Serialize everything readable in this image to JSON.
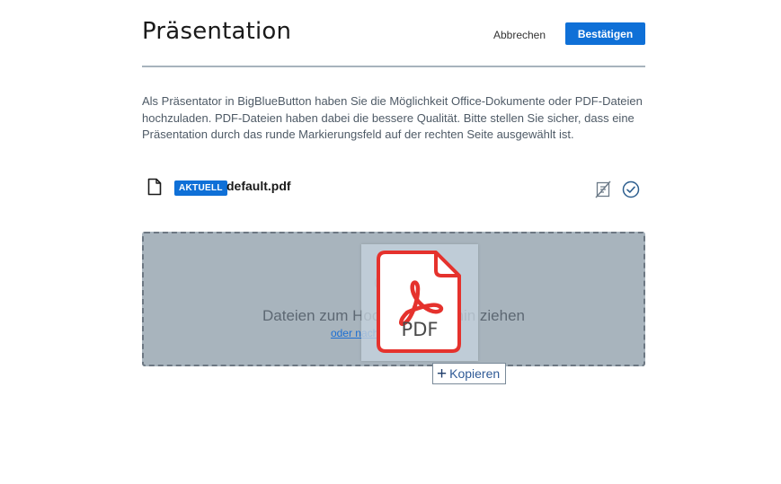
{
  "header": {
    "title": "Präsentation",
    "cancel_label": "Abbrechen",
    "confirm_label": "Bestätigen"
  },
  "description": "Als Präsentator in BigBlueButton haben Sie die Möglichkeit Office-Dokumente oder PDF-Dateien hochzuladen. PDF-Dateien haben dabei die bessere Qualität. Bitte stellen Sie sicher, dass eine Präsentation durch das runde Markierungsfeld auf der rechten Seite ausgewählt ist.",
  "files": [
    {
      "badge": "AKTUELL",
      "name": "default.pdf",
      "icons": [
        "file-icon",
        "download-disabled-icon",
        "check-circle-icon"
      ]
    }
  ],
  "dropzone": {
    "text": "Dateien zum Hochladen hierhin ziehen",
    "link": "oder nach Dateien suchen",
    "icon": "cloud-upload-icon"
  },
  "drag_ghost": {
    "label": "PDF",
    "icon": "acrobat-pdf-icon"
  },
  "drag_tooltip": {
    "symbol": "+",
    "label": "Kopieren"
  },
  "colors": {
    "primary": "#0f70d7",
    "dropzone_bg": "#a8b4bd",
    "pdf_red": "#e5322d"
  }
}
